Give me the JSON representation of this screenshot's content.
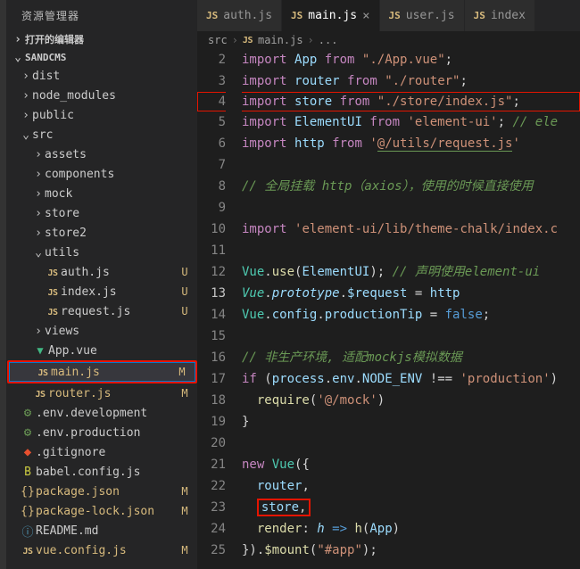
{
  "sidebar_title": "资源管理器",
  "sections": {
    "open_editors": "打开的编辑器",
    "workspace": "SANDCMS"
  },
  "tree": [
    {
      "d": 1,
      "t": "folder",
      "open": false,
      "label": "dist"
    },
    {
      "d": 1,
      "t": "folder",
      "open": false,
      "label": "node_modules"
    },
    {
      "d": 1,
      "t": "folder",
      "open": false,
      "label": "public"
    },
    {
      "d": 1,
      "t": "folder",
      "open": true,
      "label": "src"
    },
    {
      "d": 2,
      "t": "folder",
      "open": false,
      "label": "assets"
    },
    {
      "d": 2,
      "t": "folder",
      "open": false,
      "label": "components"
    },
    {
      "d": 2,
      "t": "folder",
      "open": false,
      "label": "mock"
    },
    {
      "d": 2,
      "t": "folder",
      "open": false,
      "label": "store"
    },
    {
      "d": 2,
      "t": "folder",
      "open": false,
      "label": "store2"
    },
    {
      "d": 2,
      "t": "folder",
      "open": true,
      "label": "utils"
    },
    {
      "d": 3,
      "t": "js",
      "label": "auth.js",
      "status": "U"
    },
    {
      "d": 3,
      "t": "js",
      "label": "index.js",
      "status": "U"
    },
    {
      "d": 3,
      "t": "js",
      "label": "request.js",
      "status": "U"
    },
    {
      "d": 2,
      "t": "folder",
      "open": false,
      "label": "views"
    },
    {
      "d": 2,
      "t": "vue",
      "label": "App.vue"
    },
    {
      "d": 2,
      "t": "js",
      "label": "main.js",
      "status": "M",
      "sel": true,
      "hl": true,
      "yellow": true
    },
    {
      "d": 2,
      "t": "js",
      "label": "router.js",
      "status": "M",
      "yellow": true
    },
    {
      "d": 1,
      "t": "conf",
      "label": ".env.development"
    },
    {
      "d": 1,
      "t": "conf",
      "label": ".env.production"
    },
    {
      "d": 1,
      "t": "git",
      "label": ".gitignore"
    },
    {
      "d": 1,
      "t": "babel",
      "label": "babel.config.js"
    },
    {
      "d": 1,
      "t": "json",
      "label": "package.json",
      "status": "M",
      "yellow": true
    },
    {
      "d": 1,
      "t": "json",
      "label": "package-lock.json",
      "status": "M",
      "yellow": true
    },
    {
      "d": 1,
      "t": "readme",
      "label": "README.md"
    },
    {
      "d": 1,
      "t": "js",
      "label": "vue.config.js",
      "status": "M",
      "yellow": true
    }
  ],
  "tabs": [
    {
      "label": "auth.js",
      "active": false,
      "close": false
    },
    {
      "label": "main.js",
      "active": true,
      "close": true
    },
    {
      "label": "user.js",
      "active": false,
      "close": false
    },
    {
      "label": "index",
      "active": false,
      "close": false
    }
  ],
  "breadcrumb": [
    "src",
    "main.js",
    "..."
  ],
  "code_lines": [
    {
      "n": 2,
      "tokens": [
        [
          "kw",
          "import"
        ],
        [
          "pun",
          " "
        ],
        [
          "var",
          "App"
        ],
        [
          "pun",
          " "
        ],
        [
          "kw",
          "from"
        ],
        [
          "pun",
          " "
        ],
        [
          "str",
          "\"./App.vue\""
        ],
        [
          "pun",
          ";"
        ]
      ]
    },
    {
      "n": 3,
      "tokens": [
        [
          "kw",
          "import"
        ],
        [
          "pun",
          " "
        ],
        [
          "var",
          "router"
        ],
        [
          "pun",
          " "
        ],
        [
          "kw",
          "from"
        ],
        [
          "pun",
          " "
        ],
        [
          "str",
          "\"./router\""
        ],
        [
          "pun",
          ";"
        ]
      ]
    },
    {
      "n": 4,
      "boxLeft": true,
      "tokens": [
        [
          "kw",
          "import"
        ],
        [
          "pun",
          " "
        ],
        [
          "var",
          "store"
        ],
        [
          "pun",
          " "
        ],
        [
          "kw",
          "from"
        ],
        [
          "pun",
          " "
        ],
        [
          "str",
          "\"./store/index.js\""
        ],
        [
          "pun",
          ";                "
        ]
      ]
    },
    {
      "n": 5,
      "tokens": [
        [
          "kw",
          "import"
        ],
        [
          "pun",
          " "
        ],
        [
          "var",
          "ElementUI"
        ],
        [
          "pun",
          " "
        ],
        [
          "kw",
          "from"
        ],
        [
          "pun",
          " "
        ],
        [
          "str",
          "'element-ui'"
        ],
        [
          "pun",
          "; "
        ],
        [
          "cmt",
          "// ele"
        ]
      ]
    },
    {
      "n": 6,
      "tokens": [
        [
          "kw",
          "import"
        ],
        [
          "pun",
          " "
        ],
        [
          "var",
          "http"
        ],
        [
          "pun",
          " "
        ],
        [
          "kw",
          "from"
        ],
        [
          "pun",
          " "
        ],
        [
          "str",
          "'"
        ],
        [
          "str underline",
          "@/utils/request.js"
        ],
        [
          "str",
          "'"
        ]
      ]
    },
    {
      "n": 7,
      "tokens": []
    },
    {
      "n": 8,
      "tokens": [
        [
          "cmt",
          "// 全局挂载 http（axios），使用的时候直接使用"
        ]
      ]
    },
    {
      "n": 9,
      "tokens": []
    },
    {
      "n": 10,
      "tokens": [
        [
          "kw",
          "import"
        ],
        [
          "pun",
          " "
        ],
        [
          "str",
          "'element-ui/lib/theme-chalk/index.c"
        ]
      ]
    },
    {
      "n": 11,
      "tokens": []
    },
    {
      "n": 12,
      "tokens": [
        [
          "glob",
          "Vue"
        ],
        [
          "pun",
          "."
        ],
        [
          "fn",
          "use"
        ],
        [
          "pun",
          "("
        ],
        [
          "var",
          "ElementUI"
        ],
        [
          "pun",
          "); "
        ],
        [
          "cmt",
          "// 声明使用element-ui"
        ]
      ]
    },
    {
      "n": 13,
      "cur": true,
      "tokens": [
        [
          "glob italic",
          "Vue"
        ],
        [
          "pun",
          "."
        ],
        [
          "prop italic",
          "prototype"
        ],
        [
          "pun",
          "."
        ],
        [
          "var",
          "$request"
        ],
        [
          "pun",
          " = "
        ],
        [
          "var",
          "http"
        ]
      ]
    },
    {
      "n": 14,
      "tokens": [
        [
          "glob",
          "Vue"
        ],
        [
          "pun",
          "."
        ],
        [
          "var",
          "config"
        ],
        [
          "pun",
          "."
        ],
        [
          "var",
          "productionTip"
        ],
        [
          "pun",
          " = "
        ],
        [
          "lit",
          "false"
        ],
        [
          "pun",
          ";"
        ]
      ]
    },
    {
      "n": 15,
      "tokens": []
    },
    {
      "n": 16,
      "tokens": [
        [
          "cmt",
          "// 非生产环境, 适配mockjs模拟数据"
        ]
      ]
    },
    {
      "n": 17,
      "tokens": [
        [
          "kw",
          "if"
        ],
        [
          "pun",
          " ("
        ],
        [
          "var",
          "process"
        ],
        [
          "pun",
          "."
        ],
        [
          "var",
          "env"
        ],
        [
          "pun",
          "."
        ],
        [
          "var",
          "NODE_ENV"
        ],
        [
          "pun",
          " !== "
        ],
        [
          "str",
          "'production'"
        ],
        [
          "pun",
          ")"
        ]
      ]
    },
    {
      "n": 18,
      "tokens": [
        [
          "pun",
          "  "
        ],
        [
          "fn",
          "require"
        ],
        [
          "pun",
          "("
        ],
        [
          "str",
          "'@/mock'"
        ],
        [
          "pun",
          ")"
        ]
      ]
    },
    {
      "n": 19,
      "tokens": [
        [
          "pun",
          "}"
        ]
      ]
    },
    {
      "n": 20,
      "tokens": []
    },
    {
      "n": 21,
      "tokens": [
        [
          "kw",
          "new"
        ],
        [
          "pun",
          " "
        ],
        [
          "cls",
          "Vue"
        ],
        [
          "pun",
          "({"
        ]
      ]
    },
    {
      "n": 22,
      "tokens": [
        [
          "pun",
          "  "
        ],
        [
          "var",
          "router"
        ],
        [
          "pun",
          ","
        ]
      ]
    },
    {
      "n": 23,
      "boxed": true,
      "tokens": [
        [
          "pun",
          "  "
        ],
        [
          "var",
          "store"
        ],
        [
          "pun",
          ","
        ]
      ]
    },
    {
      "n": 24,
      "tokens": [
        [
          "pun",
          "  "
        ],
        [
          "fn",
          "render"
        ],
        [
          "pun",
          ": "
        ],
        [
          "var italic",
          "h"
        ],
        [
          "pun",
          " "
        ],
        [
          "lit",
          "=>"
        ],
        [
          "pun",
          " "
        ],
        [
          "fn",
          "h"
        ],
        [
          "pun",
          "("
        ],
        [
          "var",
          "App"
        ],
        [
          "pun",
          ")"
        ]
      ]
    },
    {
      "n": 25,
      "tokens": [
        [
          "pun",
          "})."
        ],
        [
          "fn",
          "$mount"
        ],
        [
          "pun",
          "("
        ],
        [
          "str",
          "\"#app\""
        ],
        [
          "pun",
          ");"
        ]
      ]
    }
  ]
}
